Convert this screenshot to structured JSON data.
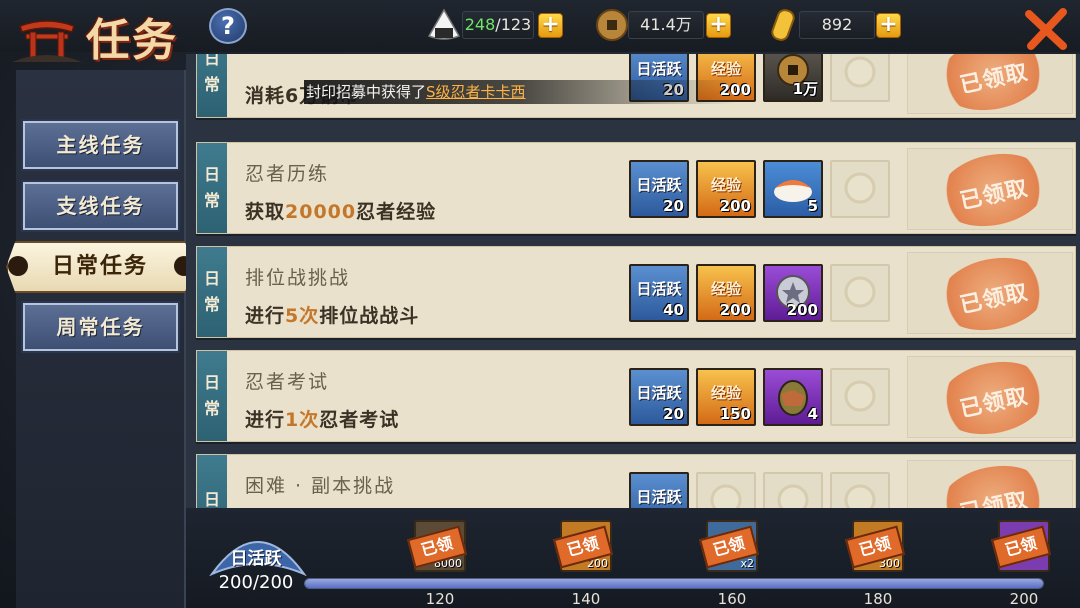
{
  "header": {
    "title": "任务",
    "help": "?",
    "stamina": {
      "current": "248",
      "max": "/123"
    },
    "coins": "41.4万",
    "gold": "892",
    "plus": "+"
  },
  "notification": {
    "text": "封印招募中获得了",
    "highlight": "S级忍者卡卡西"
  },
  "nav": {
    "items": [
      {
        "label": "主线任务"
      },
      {
        "label": "支线任务"
      },
      {
        "label": "日常任务",
        "active": true
      },
      {
        "label": "周常任务"
      }
    ]
  },
  "tasks": [
    {
      "tag1": "日",
      "tag2": "常",
      "name": "",
      "desc_pre": "消耗6万铜币",
      "num": "",
      "desc_post": "",
      "rewards": [
        {
          "type": "act",
          "label": "日活跃",
          "count": "20"
        },
        {
          "type": "exp",
          "label": "经验",
          "count": "200"
        },
        {
          "type": "coin",
          "label": "",
          "count": "1万"
        }
      ],
      "status": "已领取"
    },
    {
      "tag1": "日",
      "tag2": "常",
      "name": "忍者历练",
      "desc_pre": "获取",
      "num": "20000",
      "desc_post": "忍者经验",
      "rewards": [
        {
          "type": "act",
          "label": "日活跃",
          "count": "20"
        },
        {
          "type": "exp",
          "label": "经验",
          "count": "200"
        },
        {
          "type": "food",
          "label": "",
          "count": "5"
        }
      ],
      "status": "已领取"
    },
    {
      "tag1": "日",
      "tag2": "常",
      "name": "排位战挑战",
      "desc_pre": "进行",
      "num": "5次",
      "desc_post": "排位战战斗",
      "rewards": [
        {
          "type": "act",
          "label": "日活跃",
          "count": "40"
        },
        {
          "type": "exp",
          "label": "经验",
          "count": "200"
        },
        {
          "type": "purple",
          "label": "",
          "count": "200"
        }
      ],
      "status": "已领取"
    },
    {
      "tag1": "日",
      "tag2": "常",
      "name": "忍者考试",
      "desc_pre": "进行",
      "num": "1次",
      "desc_post": "忍者考试",
      "rewards": [
        {
          "type": "act",
          "label": "日活跃",
          "count": "20"
        },
        {
          "type": "exp",
          "label": "经验",
          "count": "150"
        },
        {
          "type": "purple",
          "label": "",
          "count": "4"
        }
      ],
      "status": "已领取"
    },
    {
      "tag1": "日",
      "tag2": "",
      "name": "困难 · 副本挑战",
      "desc_pre": "",
      "num": "",
      "desc_post": "",
      "rewards": [
        {
          "type": "act",
          "label": "日活跃",
          "count": ""
        }
      ],
      "status": "已领取"
    }
  ],
  "activity": {
    "label": "日活跃",
    "value": "200/200",
    "progress": 1.0,
    "chests": [
      {
        "milestone": "120",
        "badge": "已领",
        "count": "8000",
        "color": "#5a4a36"
      },
      {
        "milestone": "140",
        "badge": "已领",
        "count": "200",
        "color": "#c27a24"
      },
      {
        "milestone": "160",
        "badge": "已领",
        "count": "x2",
        "color": "#3e6a9c"
      },
      {
        "milestone": "180",
        "badge": "已领",
        "count": "300",
        "color": "#c27a24"
      },
      {
        "milestone": "200",
        "badge": "已领",
        "count": "",
        "color": "#7a3cae"
      }
    ]
  }
}
